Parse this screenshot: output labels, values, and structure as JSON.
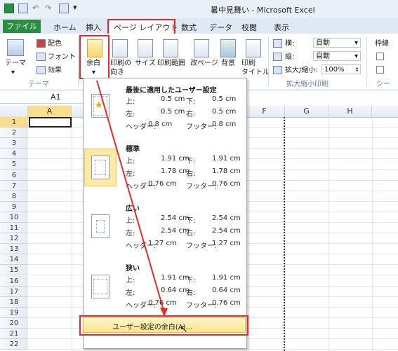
{
  "window": {
    "title": "暑中見舞い - Microsoft Excel"
  },
  "tabs": [
    {
      "label": "ファイル"
    },
    {
      "label": "ホーム"
    },
    {
      "label": "挿入"
    },
    {
      "label": "ページ レイアウト",
      "selected": true
    },
    {
      "label": "数式"
    },
    {
      "label": "データ"
    },
    {
      "label": "校閲"
    },
    {
      "label": "表示"
    }
  ],
  "ribbon": {
    "theme": {
      "label": "テーマ",
      "colors": "配色",
      "fonts": "フォント",
      "effects": "効果",
      "group": "テーマ"
    },
    "page_setup": {
      "margins": "余白",
      "orientation": "印刷の\n向き",
      "size": "サイズ",
      "print_area": "印刷範囲",
      "breaks": "改ページ",
      "background": "背景",
      "print_titles": "印刷\nタイトル"
    },
    "scale": {
      "width_label": "横:",
      "width_value": "自動",
      "height_label": "縦:",
      "height_value": "自動",
      "scale_label": "拡大/縮小:",
      "scale_value": "100%",
      "group": "拡大縮小印刷"
    },
    "sheet_options": {
      "gridlines": "枠線",
      "group": "シー"
    }
  },
  "name_box": {
    "value": "A1"
  },
  "columns": [
    "A",
    "F",
    "G",
    "H"
  ],
  "rows": [
    "1",
    "2",
    "3",
    "4",
    "5",
    "6",
    "7",
    "8",
    "9",
    "10",
    "11",
    "12",
    "13",
    "14",
    "15",
    "16",
    "17",
    "18",
    "19",
    "20",
    "21",
    "22"
  ],
  "margin_options": [
    {
      "title": "最後に適用したユーザー設定",
      "top_label": "上:",
      "top": "0.5 cm",
      "bottom_label": "下:",
      "bottom": "0.5 cm",
      "left_label": "左:",
      "left": "0.5 cm",
      "right_label": "右:",
      "right": "0.5 cm",
      "header_label": "ヘッダー:",
      "header": "0.8 cm",
      "footer_label": "フッター:",
      "footer": "0.8 cm"
    },
    {
      "title": "標準",
      "top_label": "上:",
      "top": "1.91 cm",
      "bottom_label": "下:",
      "bottom": "1.91 cm",
      "left_label": "左:",
      "left": "1.78 cm",
      "right_label": "右:",
      "right": "1.78 cm",
      "header_label": "ヘッダー:",
      "header": "0.76 cm",
      "footer_label": "フッター:",
      "footer": "0.76 cm"
    },
    {
      "title": "広い",
      "top_label": "上:",
      "top": "2.54 cm",
      "bottom_label": "下:",
      "bottom": "2.54 cm",
      "left_label": "左:",
      "left": "2.54 cm",
      "right_label": "右:",
      "right": "2.54 cm",
      "header_label": "ヘッダー:",
      "header": "1.27 cm",
      "footer_label": "フッター:",
      "footer": "1.27 cm"
    },
    {
      "title": "狭い",
      "top_label": "上:",
      "top": "1.91 cm",
      "bottom_label": "下:",
      "bottom": "1.91 cm",
      "left_label": "左:",
      "left": "0.64 cm",
      "right_label": "右:",
      "right": "0.64 cm",
      "header_label": "ヘッダー:",
      "header": "0.76 cm",
      "footer_label": "フッター:",
      "footer": "0.76 cm"
    }
  ],
  "custom_margins": {
    "label": "ユーザー設定の余白(A)..."
  },
  "colors": {
    "file_tab": "#2a8d3f",
    "highlight": "#e42b2b",
    "hover": "#fde58b"
  }
}
